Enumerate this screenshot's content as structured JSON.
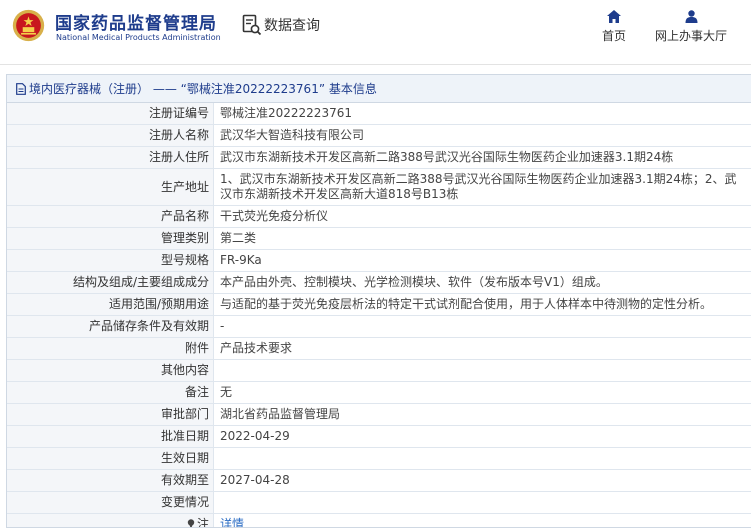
{
  "header": {
    "logo_cn": "国家药品监督管理局",
    "logo_en": "National Medical Products Administration",
    "query_label": "数据查询",
    "nav": [
      {
        "label": "首页",
        "icon": "home-icon"
      },
      {
        "label": "网上办事大厅",
        "icon": "person-icon"
      }
    ]
  },
  "panel": {
    "title": "境内医疗器械（注册） —— “鄂械注准20222223761” 基本信息"
  },
  "rows": [
    {
      "label": "注册证编号",
      "value": "鄂械注准20222223761"
    },
    {
      "label": "注册人名称",
      "value": "武汉华大智造科技有限公司"
    },
    {
      "label": "注册人住所",
      "value": "武汉市东湖新技术开发区高新二路388号武汉光谷国际生物医药企业加速器3.1期24栋"
    },
    {
      "label": "生产地址",
      "value": "1、武汉市东湖新技术开发区高新二路388号武汉光谷国际生物医药企业加速器3.1期24栋；2、武汉市东湖新技术开发区高新大道818号B13栋"
    },
    {
      "label": "产品名称",
      "value": "干式荧光免疫分析仪"
    },
    {
      "label": "管理类别",
      "value": "第二类"
    },
    {
      "label": "型号规格",
      "value": "FR-9Ka"
    },
    {
      "label": "结构及组成/主要组成成分",
      "value": "本产品由外壳、控制模块、光学检测模块、软件（发布版本号V1）组成。"
    },
    {
      "label": "适用范围/预期用途",
      "value": "与适配的基于荧光免疫层析法的特定干式试剂配合使用，用于人体样本中待测物的定性分析。"
    },
    {
      "label": "产品储存条件及有效期",
      "value": "-"
    },
    {
      "label": "附件",
      "value": "产品技术要求"
    },
    {
      "label": "其他内容",
      "value": ""
    },
    {
      "label": "备注",
      "value": "无"
    },
    {
      "label": "审批部门",
      "value": "湖北省药品监督管理局"
    },
    {
      "label": "批准日期",
      "value": "2022-04-29"
    },
    {
      "label": "生效日期",
      "value": ""
    },
    {
      "label": "有效期至",
      "value": "2027-04-28"
    },
    {
      "label": "变更情况",
      "value": ""
    },
    {
      "label": "注",
      "value": "详情"
    }
  ],
  "colors": {
    "brand_blue": "#1e3c8c",
    "link_blue": "#2a6cc4",
    "label_bg": "#f4f6f9",
    "header_bg": "#eef3f9"
  }
}
